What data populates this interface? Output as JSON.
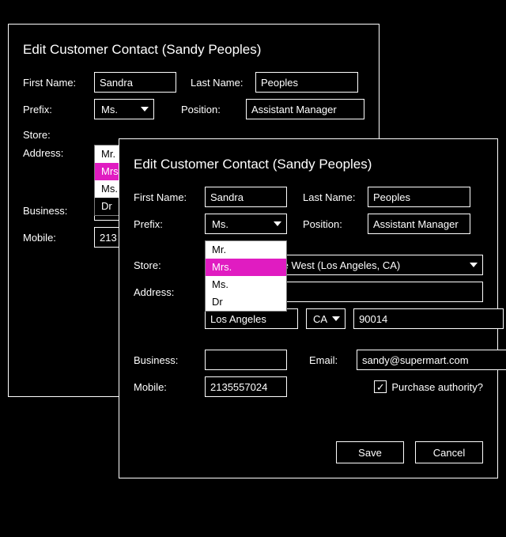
{
  "back": {
    "title": "Edit Customer Contact (Sandy Peoples)",
    "labels": {
      "first_name": "First Name:",
      "last_name": "Last Name:",
      "prefix": "Prefix:",
      "position": "Position:",
      "store": "Store:",
      "address": "Address:",
      "business": "Business:",
      "mobile": "Mobile:"
    },
    "values": {
      "first_name": "Sandra",
      "last_name": "Peoples",
      "prefix": "Ms.",
      "position": "Assistant Manager",
      "mobile_partial": "213"
    },
    "dropdown": {
      "options": [
        "Mr.",
        "Mrs.",
        "Ms.",
        "Dr"
      ],
      "highlighted": "Mrs."
    }
  },
  "front": {
    "title": "Edit Customer Contact (Sandy Peoples)",
    "labels": {
      "first_name": "First Name:",
      "last_name": "Last Name:",
      "prefix": "Prefix:",
      "position": "Position:",
      "store": "Store:",
      "address": "Address:",
      "business": "Business:",
      "mobile": "Mobile:",
      "email": "Email:",
      "purchase": "Purchase authority?"
    },
    "values": {
      "first_name": "Sandra",
      "last_name": "Peoples",
      "prefix": "Ms.",
      "position": "Assistant Manager",
      "store": "SuperMart of the West (Los Angeles, CA)",
      "address_line": "",
      "city": "Los Angeles",
      "state": "CA",
      "postal": "90014",
      "business": "",
      "email": "sandy@supermart.com",
      "mobile": "2135557024",
      "purchase_checked": true
    },
    "dropdown": {
      "options": [
        "Mr.",
        "Mrs.",
        "Ms.",
        "Dr"
      ],
      "highlighted": "Mrs."
    },
    "buttons": {
      "save": "Save",
      "cancel": "Cancel"
    },
    "checkmark": "✓"
  }
}
